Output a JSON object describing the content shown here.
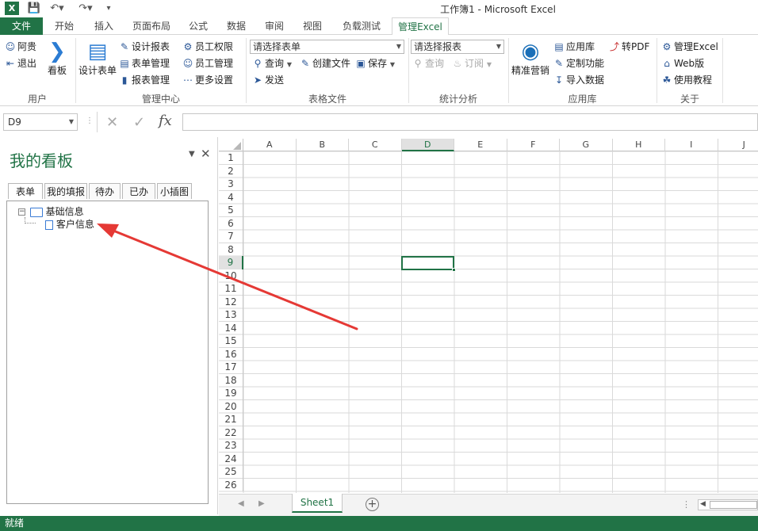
{
  "window": {
    "title": "工作簿1 - Microsoft Excel",
    "logo_text": "X"
  },
  "tabs": [
    "文件",
    "开始",
    "插入",
    "页面布局",
    "公式",
    "数据",
    "审阅",
    "视图",
    "负载测试",
    "管理Excel"
  ],
  "active_tab_index": 9,
  "ribbon": {
    "user_group": {
      "label": "用户",
      "user_name": "阿贵",
      "logout": "退出",
      "board": "看板"
    },
    "manage_group": {
      "label": "管理中心",
      "design_form": "设计表单",
      "design_report": "设计报表",
      "form_manage": "表单管理",
      "report_manage": "报表管理",
      "employee_permission": "员工权限",
      "employee_manage": "员工管理",
      "more_settings": "更多设置"
    },
    "table_group": {
      "label": "表格文件",
      "select_placeholder": "请选择表单",
      "query": "查询",
      "create_file": "创建文件",
      "save": "保存",
      "send": "发送"
    },
    "stats_group": {
      "label": "统计分析",
      "select_placeholder": "请选择报表",
      "query": "查询",
      "subscribe": "订阅"
    },
    "app_group": {
      "label": "应用库",
      "precision_marketing": "精准营销",
      "app_store": "应用库",
      "custom_function": "定制功能",
      "import_data": "导入数据",
      "to_pdf": "转PDF"
    },
    "about_group": {
      "label": "关于",
      "manage_excel": "管理Excel",
      "web_version": "Web版",
      "tutorial": "使用教程"
    }
  },
  "formula_bar": {
    "name_box": "D9",
    "cancel_symbol": "✕",
    "enter_symbol": "✓",
    "fx_symbol": "fx",
    "content": ""
  },
  "panel": {
    "title": "我的看板",
    "tabs": [
      "表单",
      "我的填报",
      "待办",
      "已办",
      "小插图"
    ],
    "active_tab_index": 0,
    "tree": {
      "root_label": "基础信息",
      "children": [
        "客户信息"
      ]
    }
  },
  "grid": {
    "columns": [
      "A",
      "B",
      "C",
      "D",
      "E",
      "F",
      "G",
      "H",
      "I",
      "J"
    ],
    "rows": [
      "1",
      "2",
      "3",
      "4",
      "5",
      "6",
      "7",
      "8",
      "9",
      "10",
      "11",
      "12",
      "13",
      "14",
      "15",
      "16",
      "17",
      "18",
      "19",
      "20",
      "21",
      "22",
      "23",
      "24",
      "25",
      "26"
    ],
    "selected_cell": "D9",
    "selected_column": "D",
    "selected_row": "9"
  },
  "sheets": {
    "tabs": [
      "Sheet1"
    ],
    "active": "Sheet1"
  },
  "status_bar": {
    "text": "就绪"
  },
  "colors": {
    "excel_green": "#217346",
    "annotation_arrow": "#e53935"
  }
}
